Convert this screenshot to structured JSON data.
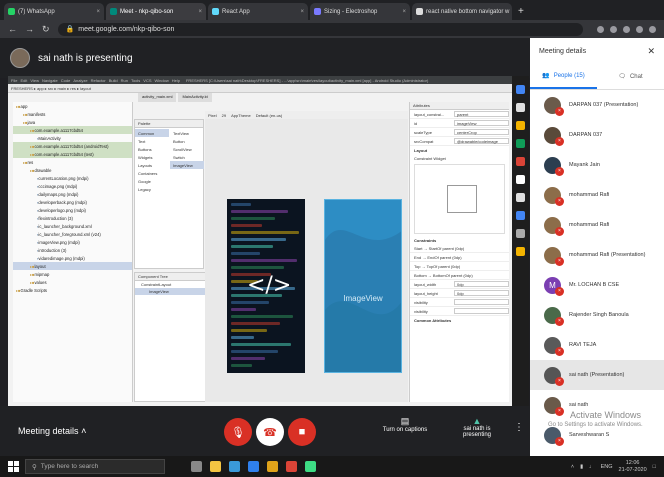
{
  "tabs": [
    {
      "label": "(7) WhatsApp",
      "color": "#25d366"
    },
    {
      "label": "Meet - nkp-qibo-son",
      "color": "#00897b"
    },
    {
      "label": "React App",
      "color": "#61dafb"
    },
    {
      "label": "Sizing - Electroshop",
      "color": "#7a7aff"
    },
    {
      "label": "react native bottom navigator w",
      "color": "#dddddd"
    }
  ],
  "url": "meet.google.com/nkp-qibo-son",
  "presenter_banner": "sai nath is presenting",
  "studio": {
    "window_title": "FRESHERS [C:\\Users\\sai nath\\Desktop\\FRESHERS] - ...\\app\\src\\main\\res\\layout\\activity_main.xml [app] - Android Studio (Administrator)",
    "menu": [
      "File",
      "Edit",
      "View",
      "Navigate",
      "Code",
      "Analyze",
      "Refactor",
      "Build",
      "Run",
      "Tools",
      "VCS",
      "Window",
      "Help"
    ],
    "editor_tabs": [
      "activity_main.xml",
      "MainActivity.kt"
    ],
    "tree": [
      {
        "t": "app",
        "d": 0
      },
      {
        "t": "manifests",
        "d": 1
      },
      {
        "t": "java",
        "d": 1
      },
      {
        "t": "com.example.a1117cbd54",
        "d": 2,
        "hl": true
      },
      {
        "t": "MainActivity",
        "d": 3
      },
      {
        "t": "com.example.a1117cbd54 (androidTest)",
        "d": 2,
        "hl": true
      },
      {
        "t": "com.example.a1117cbd54 (test)",
        "d": 2,
        "hl": true
      },
      {
        "t": "res",
        "d": 1
      },
      {
        "t": "drawable",
        "d": 2
      },
      {
        "t": "currentLocation.png (mdpi)",
        "d": 3
      },
      {
        "t": "cccimage.png (mdpi)",
        "d": 3
      },
      {
        "t": "dailymaps.png (mdpi)",
        "d": 3
      },
      {
        "t": "developerback.png (mdpi)",
        "d": 3
      },
      {
        "t": "developerlogo.png (mdpi)",
        "d": 3
      },
      {
        "t": "flexintroduction (3)",
        "d": 3
      },
      {
        "t": "ic_launcher_background.xml",
        "d": 3
      },
      {
        "t": "ic_launcher_foreground.xml (v24)",
        "d": 3
      },
      {
        "t": "imageView.png (mdpi)",
        "d": 3
      },
      {
        "t": "introduction (3)",
        "d": 3
      },
      {
        "t": "vidaredimage.png (mdpi)",
        "d": 3
      },
      {
        "t": "layout",
        "d": 2,
        "sel": true
      },
      {
        "t": "mipmap",
        "d": 2
      },
      {
        "t": "values",
        "d": 2
      },
      {
        "t": "Gradle Scripts",
        "d": 0
      }
    ],
    "palette_header": "Palette",
    "palette_groups": [
      "Common",
      "Text",
      "Buttons",
      "Widgets",
      "Layouts",
      "Containers",
      "Google",
      "Legacy"
    ],
    "palette_items": [
      "TextView",
      "Button",
      "ScrollView",
      "Switch",
      "ImageView"
    ],
    "component_header": "Component Tree",
    "component_items": [
      "ConstraintLayout",
      "ImageView"
    ],
    "design_toolbar": [
      "Pixel",
      "29",
      "AppTheme",
      "Default (en-us)"
    ],
    "imageview_label": "ImageView",
    "attributes_header": "Attributes",
    "attr_rows": [
      {
        "k": "layout_constrai...",
        "v": "parent"
      },
      {
        "k": "id",
        "v": "imageView"
      },
      {
        "k": "scaleType",
        "v": "centerCrop"
      },
      {
        "k": "srcCompat",
        "v": "@drawable/codeimage"
      }
    ],
    "layout_section": "Layout",
    "constraint_widget": "Constraint Widget",
    "constraints_section": "Constraints",
    "constraints": [
      "Start → StartOf parent (0dp)",
      "End → EndOf parent (0dp)",
      "Top → TopOf parent (0dp)",
      "Bottom → BottomOf parent (0dp)"
    ],
    "attr_rows2": [
      {
        "k": "layout_width",
        "v": "0dp"
      },
      {
        "k": "layout_height",
        "v": "0dp"
      },
      {
        "k": "visibility",
        "v": ""
      },
      {
        "k": "visibility",
        "v": ""
      }
    ],
    "common_section": "Common Attributes"
  },
  "panel": {
    "title": "Meeting details",
    "people_tab": "People (15)",
    "chat_tab": "Chat",
    "people": [
      {
        "name": "DARPAN 037 (Presentation)",
        "c": "#6b5b4b"
      },
      {
        "name": "DARPAN 037",
        "c": "#5a4a3a"
      },
      {
        "name": "Mayank Jain",
        "c": "#2c3e50"
      },
      {
        "name": "mohammad Rafi",
        "c": "#8c6d4a"
      },
      {
        "name": "mohammad Rafi",
        "c": "#8c6d4a"
      },
      {
        "name": "mohammad Rafi (Presentation)",
        "c": "#8c6d4a"
      },
      {
        "name": "Mr. LOCHAN B CSE",
        "c": "#7b3fb2",
        "initial": "M"
      },
      {
        "name": "Rajender Singh Banoula",
        "c": "#4a6a4a"
      },
      {
        "name": "RAVI TEJA",
        "c": "#5a5a5a"
      },
      {
        "name": "sai nath (Presentation)",
        "c": "#555555",
        "self": true
      },
      {
        "name": "sai nath",
        "c": "#6a5a4a"
      },
      {
        "name": "Sarveshwaran S",
        "c": "#4a5a6a"
      }
    ],
    "watermark": "Activate Windows",
    "watermark_sub": "Go to Settings to activate Windows."
  },
  "bottom": {
    "meeting_details": "Meeting details",
    "captions": "Turn on captions",
    "presenting": "sai nath is presenting"
  },
  "taskbar": {
    "search": "Type here to search",
    "lang": "ENG",
    "time": "12:06",
    "date": "21-07-2020"
  }
}
